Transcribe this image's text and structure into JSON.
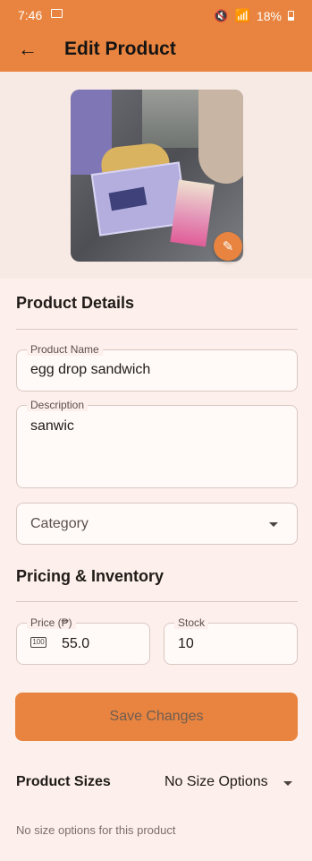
{
  "status_bar": {
    "time": "7:46",
    "battery": "18%"
  },
  "app_bar": {
    "title": "Edit Product"
  },
  "details": {
    "heading": "Product Details",
    "product_name_label": "Product Name",
    "product_name_value": "egg drop sandwich",
    "description_label": "Description",
    "description_value": "sanwic",
    "category_placeholder": "Category"
  },
  "pricing": {
    "heading": "Pricing & Inventory",
    "price_label": "Price (₱)",
    "price_value": "55.0",
    "stock_label": "Stock",
    "stock_value": "10"
  },
  "actions": {
    "save_label": "Save Changes"
  },
  "sizes": {
    "label": "Product Sizes",
    "selected": "No Size Options",
    "note": "No size options for this product"
  },
  "colors": {
    "accent": "#e8843f",
    "background": "#fdefeb"
  }
}
